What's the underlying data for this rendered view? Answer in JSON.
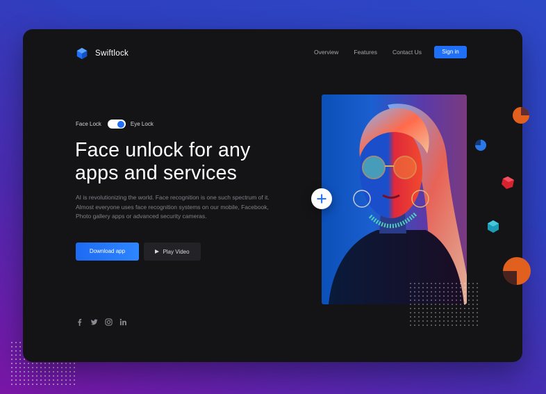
{
  "brand": {
    "name": "Swiftlock"
  },
  "nav": {
    "links": [
      "Overview",
      "Features",
      "Contact Us"
    ],
    "signin_label": "Sign in"
  },
  "toggle": {
    "left_label": "Face Lock",
    "right_label": "Eye Lock",
    "state": "Eye Lock"
  },
  "hero": {
    "title": "Face unlock for any apps and services",
    "description": "AI is revolutionizing the world. Face recognition is one such spectrum of it. Almost everyone uses face recognition systems on our mobile, Facebook, Photo gallery apps or advanced security cameras."
  },
  "buttons": {
    "download_label": "Download app",
    "play_label": "Play Video"
  },
  "social_icons": [
    "facebook-icon",
    "twitter-icon",
    "instagram-icon",
    "linkedin-icon"
  ],
  "colors": {
    "accent": "#1f6ff7",
    "panel": "#141416"
  }
}
